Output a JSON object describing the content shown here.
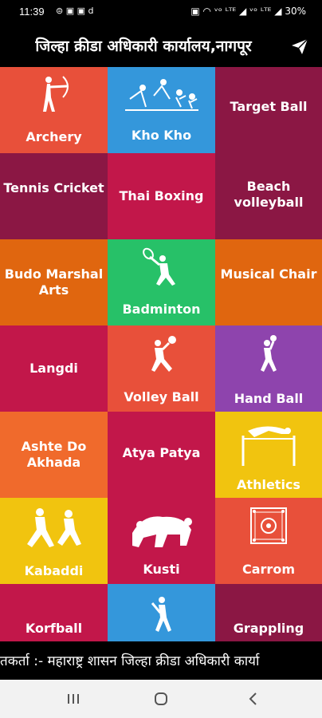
{
  "status": {
    "time": "11:39",
    "battery": "30%",
    "left_icons": "⊜ ▣ ▣ d",
    "right_icons": "▣ ◠ ᵛᵒ ᴸᵀᴱ ◢ ᵛᵒ ᴸᵀᴱ ◢"
  },
  "header": {
    "title": "जिल्हा क्रीडा अधिकारी कार्यालय,नागपूर"
  },
  "tiles": [
    {
      "label": "Archery",
      "color": "#e8503a",
      "icon": "archer-icon"
    },
    {
      "label": "Kho Kho",
      "color": "#3497db",
      "icon": "kho-kho-icon"
    },
    {
      "label": "Target Ball",
      "color": "#8b1744"
    },
    {
      "label": "Tennis Cricket",
      "color": "#8b1744"
    },
    {
      "label": "Thai Boxing",
      "color": "#c2174a"
    },
    {
      "label": "Beach volleyball",
      "color": "#8b1744"
    },
    {
      "label": "Budo Marshal Arts",
      "color": "#e0660f"
    },
    {
      "label": "Badminton",
      "color": "#27c168",
      "icon": "badminton-icon"
    },
    {
      "label": "Musical Chair",
      "color": "#e0660f"
    },
    {
      "label": "Langdi",
      "color": "#c2174a"
    },
    {
      "label": "Volley Ball",
      "color": "#e8503a",
      "icon": "volleyball-icon"
    },
    {
      "label": "Hand Ball",
      "color": "#8e44ad",
      "icon": "handball-icon"
    },
    {
      "label": "Ashte Do Akhada",
      "color": "#f06a2c"
    },
    {
      "label": "Atya Patya",
      "color": "#c2174a"
    },
    {
      "label": "Athletics",
      "color": "#f1c40f",
      "icon": "high-jump-icon"
    },
    {
      "label": "Kabaddi",
      "color": "#f1c40f",
      "icon": "kabaddi-icon"
    },
    {
      "label": "Kusti",
      "color": "#c2174a",
      "icon": "wrestling-icon"
    },
    {
      "label": "Carrom",
      "color": "#e8503a",
      "icon": "carrom-icon"
    },
    {
      "label": "Korfball",
      "color": "#c2174a"
    },
    {
      "label": "",
      "color": "#3497db",
      "icon": "cricket-icon"
    },
    {
      "label": "Grappling",
      "color": "#8b1744"
    }
  ],
  "marquee": {
    "text": "तकर्ता :- महाराष्ट्र शासन जिल्हा क्रीडा अधिकारी कार्या"
  }
}
